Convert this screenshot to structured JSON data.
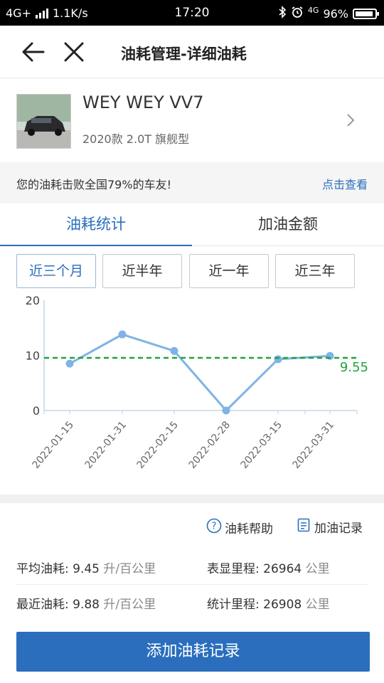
{
  "status_bar": {
    "network": "4G+",
    "speed": "1.1K/s",
    "time": "17:20",
    "signal2": "4G",
    "battery": "96%"
  },
  "header": {
    "title": "油耗管理-详细油耗"
  },
  "car": {
    "name": "WEY WEY VV7",
    "model": "2020款 2.0T 旗舰型"
  },
  "banner": {
    "text": "您的油耗击败全国79%的车友!",
    "link": "点击查看"
  },
  "tabs": [
    {
      "label": "油耗统计",
      "active": true
    },
    {
      "label": "加油金额",
      "active": false
    }
  ],
  "ranges": [
    {
      "label": "近三个月",
      "active": true
    },
    {
      "label": "近半年",
      "active": false
    },
    {
      "label": "近一年",
      "active": false
    },
    {
      "label": "近三年",
      "active": false
    }
  ],
  "chart_data": {
    "type": "line",
    "x": [
      "2022-01-15",
      "2022-01-31",
      "2022-02-15",
      "2022-02-28",
      "2022-03-15",
      "2022-03-31"
    ],
    "series": [
      {
        "values": [
          8.5,
          13.8,
          10.8,
          0,
          9.3,
          9.9
        ]
      }
    ],
    "reference_line": {
      "value": 9.55,
      "label": "9.55"
    },
    "y_ticks": [
      "0",
      "10",
      "20"
    ],
    "ylim": [
      0,
      20
    ],
    "grid": false,
    "colors": {
      "line": "#7fb3e6",
      "reference": "#1fa33a",
      "axis": "#c8d6e5"
    }
  },
  "links": {
    "help": "油耗帮助",
    "records": "加油记录"
  },
  "stats": {
    "avg_label": "平均油耗:",
    "avg_value": "9.45",
    "avg_unit": "升/百公里",
    "odometer_label": "表显里程:",
    "odometer_value": "26964",
    "odometer_unit": "公里",
    "recent_label": "最近油耗:",
    "recent_value": "9.88",
    "recent_unit": "升/百公里",
    "stat_mileage_label": "统计里程:",
    "stat_mileage_value": "26908",
    "stat_mileage_unit": "公里"
  },
  "cta": {
    "label": "添加油耗记录"
  },
  "colors": {
    "accent": "#2a6ebd"
  }
}
